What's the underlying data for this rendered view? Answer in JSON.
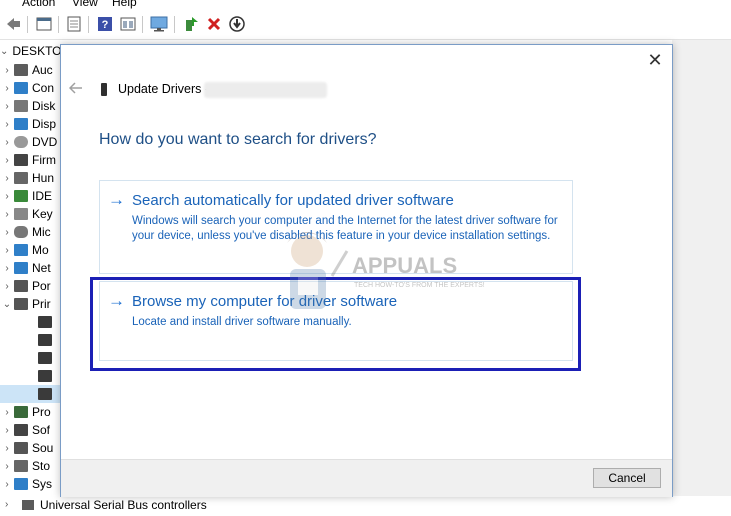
{
  "menubar": {
    "items": [
      "Action",
      "View",
      "Help"
    ]
  },
  "toolbar": {
    "icons": [
      "back-arrow-icon",
      "properties-icon",
      "scan-icon",
      "help-icon",
      "details-icon",
      "monitor-icon",
      "enable-device-icon",
      "remove-device-icon",
      "update-driver-icon"
    ]
  },
  "tree": {
    "root": "DESKTO",
    "items": [
      {
        "label": "Auc"
      },
      {
        "label": "Con"
      },
      {
        "label": "Disk"
      },
      {
        "label": "Disp"
      },
      {
        "label": "DVD"
      },
      {
        "label": "Firm"
      },
      {
        "label": "Hun"
      },
      {
        "label": "IDE"
      },
      {
        "label": "Key"
      },
      {
        "label": "Mic"
      },
      {
        "label": "Mo"
      },
      {
        "label": "Net"
      },
      {
        "label": "Por"
      },
      {
        "label": "Prir"
      }
    ],
    "items_after": [
      {
        "label": "Pro"
      },
      {
        "label": "Sof"
      },
      {
        "label": "Sou"
      },
      {
        "label": "Sto"
      },
      {
        "label": "Sys"
      }
    ],
    "bottom_item": "Universal Serial Bus controllers"
  },
  "dialog": {
    "title": "Update Drivers -",
    "heading": "How do you want to search for drivers?",
    "option1": {
      "title": "Search automatically for updated driver software",
      "description": "Windows will search your computer and the Internet for the latest driver software for your device, unless you've disabled this feature in your device installation settings."
    },
    "option2": {
      "title": "Browse my computer for driver software",
      "description": "Locate and install driver software manually."
    },
    "cancel_label": "Cancel"
  },
  "watermark": {
    "brand": "APPUALS",
    "tagline": "TECH HOW-TO'S FROM THE EXPERTS!"
  },
  "colors": {
    "link": "#1a63b8",
    "heading": "#1e4f86",
    "highlight": "#1b1fb5"
  }
}
